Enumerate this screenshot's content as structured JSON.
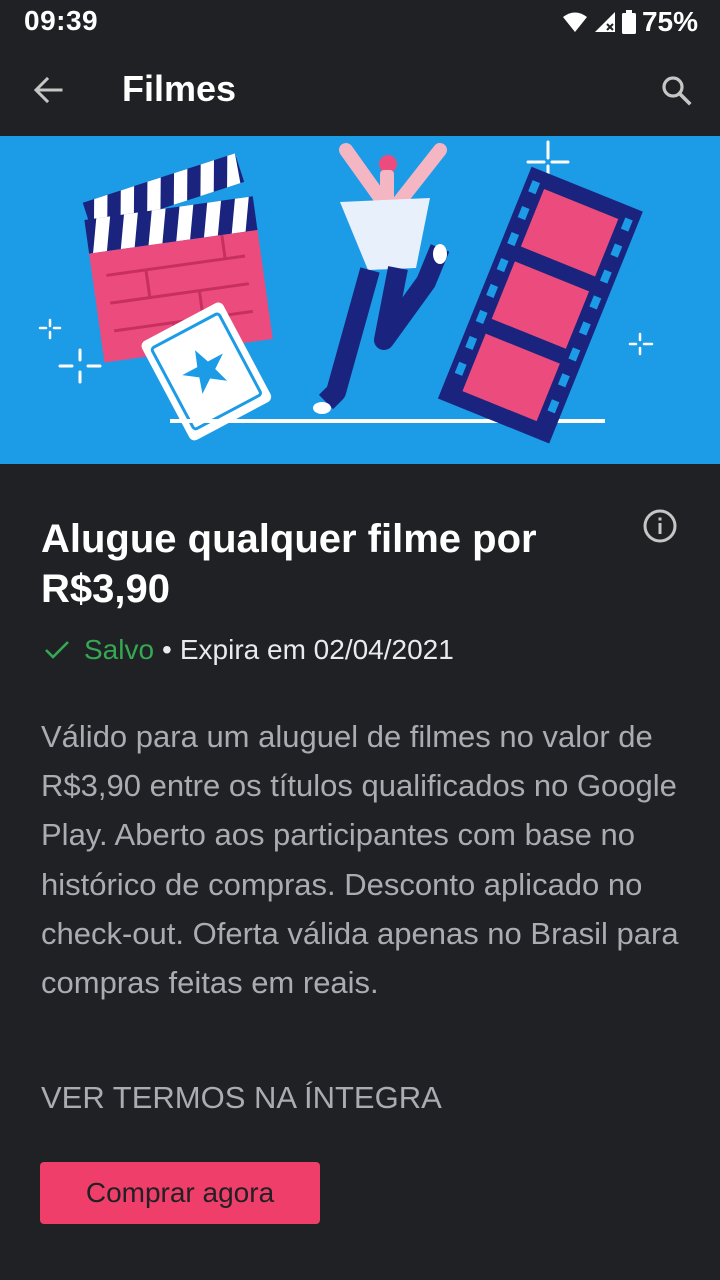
{
  "status_bar": {
    "time": "09:39",
    "battery": "75%",
    "icons": [
      "wifi-icon",
      "signal-icon",
      "battery-icon"
    ]
  },
  "app_bar": {
    "title": "Filmes",
    "back_icon": "arrow-back-icon",
    "search_icon": "search-icon"
  },
  "banner": {
    "illustration": "movie-celebration-illustration",
    "background": "#1c9be6"
  },
  "offer": {
    "title": "Alugue qualquer filme por R$3,90",
    "saved_label": "Salvo",
    "separator": "•",
    "expiry": "Expira em 02/04/2021",
    "description": "Válido para um aluguel de filmes no valor de R$3,90 entre os títulos qualificados no Google Play. Aberto aos participantes com base no histórico de compras. Desconto aplicado no check-out. Oferta válida apenas no Brasil para compras feitas em reais.",
    "terms_link": "VER TERMOS NA ÍNTEGRA",
    "buy_button": "Comprar agora"
  },
  "colors": {
    "background": "#202124",
    "accent": "#f03e6a",
    "saved_green": "#34a853",
    "banner_blue": "#1c9be6"
  }
}
